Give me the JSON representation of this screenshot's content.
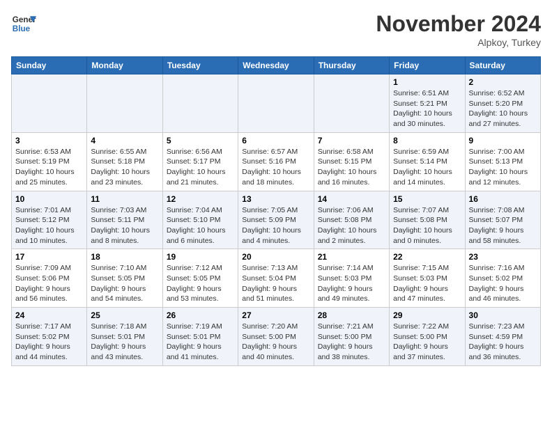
{
  "header": {
    "logo_line1": "General",
    "logo_line2": "Blue",
    "month": "November 2024",
    "location": "Alpkoy, Turkey"
  },
  "days_of_week": [
    "Sunday",
    "Monday",
    "Tuesday",
    "Wednesday",
    "Thursday",
    "Friday",
    "Saturday"
  ],
  "weeks": [
    [
      {
        "day": "",
        "info": ""
      },
      {
        "day": "",
        "info": ""
      },
      {
        "day": "",
        "info": ""
      },
      {
        "day": "",
        "info": ""
      },
      {
        "day": "",
        "info": ""
      },
      {
        "day": "1",
        "info": "Sunrise: 6:51 AM\nSunset: 5:21 PM\nDaylight: 10 hours and 30 minutes."
      },
      {
        "day": "2",
        "info": "Sunrise: 6:52 AM\nSunset: 5:20 PM\nDaylight: 10 hours and 27 minutes."
      }
    ],
    [
      {
        "day": "3",
        "info": "Sunrise: 6:53 AM\nSunset: 5:19 PM\nDaylight: 10 hours and 25 minutes."
      },
      {
        "day": "4",
        "info": "Sunrise: 6:55 AM\nSunset: 5:18 PM\nDaylight: 10 hours and 23 minutes."
      },
      {
        "day": "5",
        "info": "Sunrise: 6:56 AM\nSunset: 5:17 PM\nDaylight: 10 hours and 21 minutes."
      },
      {
        "day": "6",
        "info": "Sunrise: 6:57 AM\nSunset: 5:16 PM\nDaylight: 10 hours and 18 minutes."
      },
      {
        "day": "7",
        "info": "Sunrise: 6:58 AM\nSunset: 5:15 PM\nDaylight: 10 hours and 16 minutes."
      },
      {
        "day": "8",
        "info": "Sunrise: 6:59 AM\nSunset: 5:14 PM\nDaylight: 10 hours and 14 minutes."
      },
      {
        "day": "9",
        "info": "Sunrise: 7:00 AM\nSunset: 5:13 PM\nDaylight: 10 hours and 12 minutes."
      }
    ],
    [
      {
        "day": "10",
        "info": "Sunrise: 7:01 AM\nSunset: 5:12 PM\nDaylight: 10 hours and 10 minutes."
      },
      {
        "day": "11",
        "info": "Sunrise: 7:03 AM\nSunset: 5:11 PM\nDaylight: 10 hours and 8 minutes."
      },
      {
        "day": "12",
        "info": "Sunrise: 7:04 AM\nSunset: 5:10 PM\nDaylight: 10 hours and 6 minutes."
      },
      {
        "day": "13",
        "info": "Sunrise: 7:05 AM\nSunset: 5:09 PM\nDaylight: 10 hours and 4 minutes."
      },
      {
        "day": "14",
        "info": "Sunrise: 7:06 AM\nSunset: 5:08 PM\nDaylight: 10 hours and 2 minutes."
      },
      {
        "day": "15",
        "info": "Sunrise: 7:07 AM\nSunset: 5:08 PM\nDaylight: 10 hours and 0 minutes."
      },
      {
        "day": "16",
        "info": "Sunrise: 7:08 AM\nSunset: 5:07 PM\nDaylight: 9 hours and 58 minutes."
      }
    ],
    [
      {
        "day": "17",
        "info": "Sunrise: 7:09 AM\nSunset: 5:06 PM\nDaylight: 9 hours and 56 minutes."
      },
      {
        "day": "18",
        "info": "Sunrise: 7:10 AM\nSunset: 5:05 PM\nDaylight: 9 hours and 54 minutes."
      },
      {
        "day": "19",
        "info": "Sunrise: 7:12 AM\nSunset: 5:05 PM\nDaylight: 9 hours and 53 minutes."
      },
      {
        "day": "20",
        "info": "Sunrise: 7:13 AM\nSunset: 5:04 PM\nDaylight: 9 hours and 51 minutes."
      },
      {
        "day": "21",
        "info": "Sunrise: 7:14 AM\nSunset: 5:03 PM\nDaylight: 9 hours and 49 minutes."
      },
      {
        "day": "22",
        "info": "Sunrise: 7:15 AM\nSunset: 5:03 PM\nDaylight: 9 hours and 47 minutes."
      },
      {
        "day": "23",
        "info": "Sunrise: 7:16 AM\nSunset: 5:02 PM\nDaylight: 9 hours and 46 minutes."
      }
    ],
    [
      {
        "day": "24",
        "info": "Sunrise: 7:17 AM\nSunset: 5:02 PM\nDaylight: 9 hours and 44 minutes."
      },
      {
        "day": "25",
        "info": "Sunrise: 7:18 AM\nSunset: 5:01 PM\nDaylight: 9 hours and 43 minutes."
      },
      {
        "day": "26",
        "info": "Sunrise: 7:19 AM\nSunset: 5:01 PM\nDaylight: 9 hours and 41 minutes."
      },
      {
        "day": "27",
        "info": "Sunrise: 7:20 AM\nSunset: 5:00 PM\nDaylight: 9 hours and 40 minutes."
      },
      {
        "day": "28",
        "info": "Sunrise: 7:21 AM\nSunset: 5:00 PM\nDaylight: 9 hours and 38 minutes."
      },
      {
        "day": "29",
        "info": "Sunrise: 7:22 AM\nSunset: 5:00 PM\nDaylight: 9 hours and 37 minutes."
      },
      {
        "day": "30",
        "info": "Sunrise: 7:23 AM\nSunset: 4:59 PM\nDaylight: 9 hours and 36 minutes."
      }
    ]
  ]
}
